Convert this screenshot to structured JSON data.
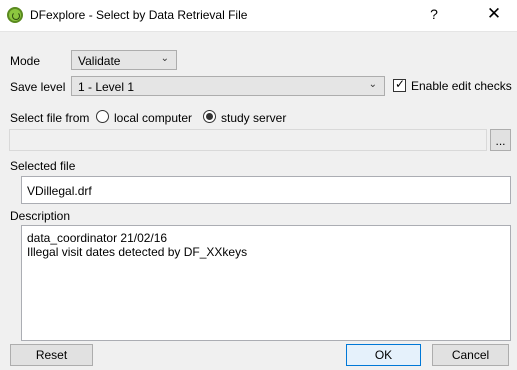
{
  "window": {
    "title": "DFexplore - Select by Data Retrieval File",
    "help_glyph": "?",
    "close_glyph": "✕"
  },
  "mode": {
    "label": "Mode",
    "value": "Validate"
  },
  "save_level": {
    "label": "Save level",
    "value": "1 - Level 1"
  },
  "edit_checks": {
    "label": "Enable edit checks",
    "checked": true,
    "check_glyph": "✓"
  },
  "select_from": {
    "label": "Select file from",
    "options": [
      {
        "label": "local computer",
        "selected": false
      },
      {
        "label": "study server",
        "selected": true
      }
    ]
  },
  "file_path": {
    "value": "",
    "browse_label": "..."
  },
  "selected_file": {
    "label": "Selected file",
    "value": "VDillegal.drf"
  },
  "description": {
    "label": "Description",
    "value": "data_coordinator 21/02/16\nIllegal visit dates detected by DF_XXkeys"
  },
  "buttons": {
    "reset": "Reset",
    "ok": "OK",
    "cancel": "Cancel"
  },
  "icons": {
    "app": "dfexplore-app-icon",
    "chevron": "chevron-down-icon"
  },
  "colors": {
    "accent": "#0078d7",
    "app_icon": "#8cc63f"
  }
}
